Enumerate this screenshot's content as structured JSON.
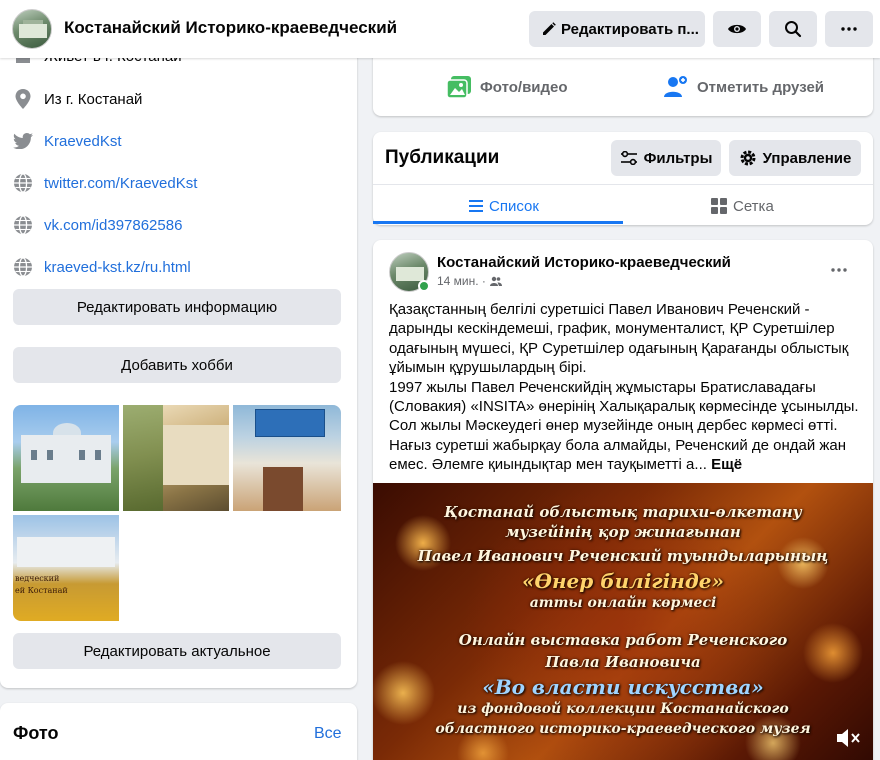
{
  "header": {
    "page_title": "Костанайский Историко-краеведческий",
    "edit_page_label": "Редактировать п..."
  },
  "intro": {
    "rows": [
      {
        "text": "Живет в г. Костанай",
        "icon": "home-icon"
      },
      {
        "text": "Из г. Костанай",
        "icon": "location-pin-icon"
      },
      {
        "text": "KraevedKst",
        "icon": "twitter-icon"
      },
      {
        "text": "twitter.com/KraevedKst",
        "icon": "globe-icon"
      },
      {
        "text": "vk.com/id397862586",
        "icon": "globe-icon"
      },
      {
        "text": "kraeved-kst.kz/ru.html",
        "icon": "globe-icon"
      }
    ],
    "edit_info_label": "Редактировать информацию",
    "add_hobby_label": "Добавить хобби",
    "photo_caption": "ведческий\nей Костанай",
    "edit_featured_label": "Редактировать актуальное"
  },
  "photos_card": {
    "title": "Фото",
    "all_label": "Все"
  },
  "composer": {
    "photo_video_label": "Фото/видео",
    "tag_friends_label": "Отметить друзей"
  },
  "publications": {
    "title": "Публикации",
    "filters_label": "Фильтры",
    "manage_label": "Управление",
    "tab_list_label": "Список",
    "tab_grid_label": "Сетка"
  },
  "post": {
    "author": "Костанайский Историко-краеведческий",
    "time": "14 мин. ·",
    "paragraph1": "Қазақстанның белгілі суретшісі Павел Иванович Реченский - дарынды кескіндемеші, график, монументалист, ҚР Суретшілер одағының мүшесі, ҚР Суретшілер одағының Қарағанды облыстық ұйымын құрушылардың бірі.",
    "paragraph2": "1997 жылы Павел Реченскийдің жұмыстары Братиславадағы (Словакия) «INSITA» өнерінің Халықаралық көрмесінде ұсынылды. Сол жылы Мәскеудегі өнер музейінде оның дербес көрмесі өтті. Нағыз суретші жабырқау бола алмайды, Реченский де ондай жан емес. Әлемге қиындықтар мен тауқыметті  а...",
    "see_more_label": "Ещё",
    "image_lines": [
      "Қостанай облыстық тарихи-өлкетану",
      "музейінің қор жинағынан",
      "Павел Иванович Реченский туындыларының",
      "«Өнер билігінде»",
      "атты онлайн көрмесі",
      "Онлайн выставка работ Реченского",
      "Павла Ивановича",
      "«Во власти искусства»",
      "из фондовой коллекции Костанайского",
      "областного историко-краеведческого музея"
    ]
  },
  "colors": {
    "link": "#216fdb",
    "accent": "#1877f2",
    "button_bg": "#e4e6eb",
    "online": "#31a24c"
  }
}
